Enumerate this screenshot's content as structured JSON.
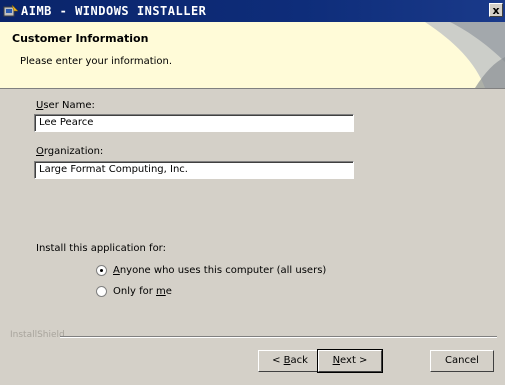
{
  "window": {
    "title": "AIMB - WINDOWS INSTALLER",
    "close_glyph": "x"
  },
  "banner": {
    "title": "Customer Information",
    "subtitle": "Please enter your information."
  },
  "form": {
    "user_name": {
      "label_first": "U",
      "label_rest": "ser Name:",
      "value": "Lee Pearce"
    },
    "organization": {
      "label_first": "O",
      "label_rest": "rganization:",
      "value": "Large Format Computing, Inc."
    },
    "install_for_label": "Install this application for:",
    "options": [
      {
        "ul": "A",
        "rest": "nyone who uses this computer (all users)",
        "selected": true
      },
      {
        "pre": "Only for ",
        "ul": "m",
        "rest": "e",
        "selected": false
      }
    ]
  },
  "footer": {
    "brand": "InstallShield",
    "back": {
      "pre": "< ",
      "ul": "B",
      "rest": "ack"
    },
    "next": {
      "ul": "N",
      "rest": "ext >"
    },
    "cancel": "Cancel"
  },
  "icons": {
    "title_icon": "installer-icon",
    "banner_art": "gray-swoosh"
  }
}
